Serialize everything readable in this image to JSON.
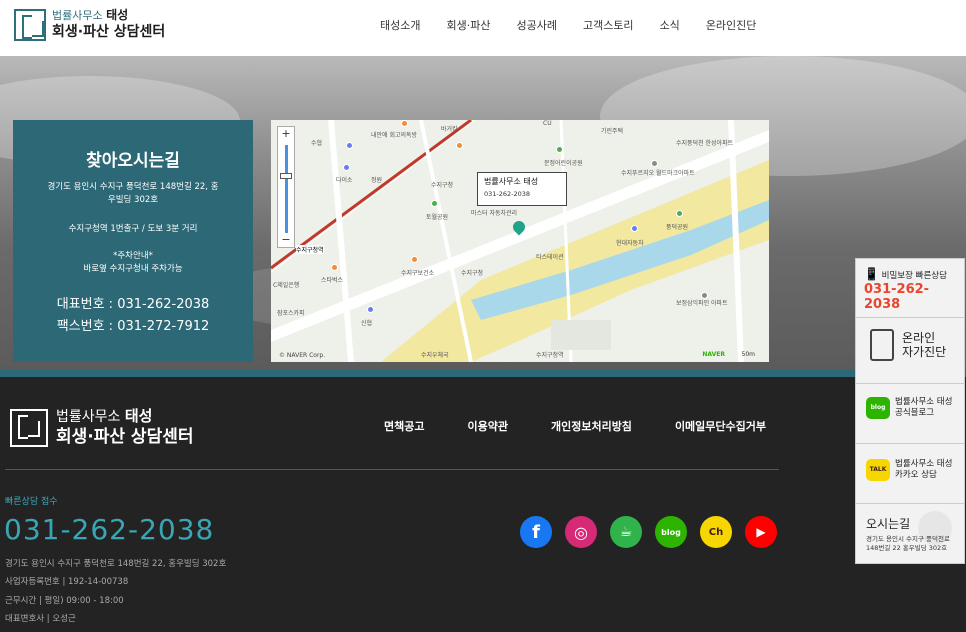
{
  "header": {
    "logo_line1_prefix": "법률사무소",
    "logo_line1_bold": "태성",
    "logo_line2": "회생·파산 상담센터",
    "nav": [
      "태성소개",
      "회생·파산",
      "성공사례",
      "고객스토리",
      "소식",
      "온라인진단"
    ]
  },
  "location": {
    "title": "찾아오시는길",
    "address": "경기도 용인시 수지구 풍덕천로 148번길 22, 홍우빌딩 302호",
    "transit": "수지구청역 1번출구 / 도보 3분 거리",
    "parking_title": "*주차안내*",
    "parking_text": "바로옆 수지구청내 주차가능",
    "phone_label": "대표번호 : 031-262-2038",
    "fax_label": "팩스번호 : 031-272-7912"
  },
  "map": {
    "callout_name": "법률사무소 태성",
    "callout_phone": "031-262-2038",
    "labels": [
      "수협",
      "내안애 회고의독방",
      "바거킹",
      "CU",
      "기린주택",
      "다이소",
      "정원",
      "수지구청",
      "문정어린이공원",
      "수지푸르지오 월드마크아파트",
      "수지중학교",
      "수지풍덕천 한성아파트",
      "농협",
      "토월공원",
      "마스터 자동차관리",
      "풍덕공원",
      "현대자동차",
      "수지구청역",
      "천운당",
      "농협",
      "티스테이션",
      "C제일은행",
      "수지구보건소",
      "수지구청",
      "스타벅스",
      "인팩",
      "법조타운7번길",
      "잠포스카피",
      "수지구청역",
      "수지우체국",
      "보정삼익파인 아파트",
      "신협"
    ],
    "zoom_plus": "+",
    "zoom_minus": "−",
    "provider": "NAVER",
    "corp": "© NAVER Corp.",
    "scale": "50m"
  },
  "footer": {
    "logo_line1_prefix": "법률사무소",
    "logo_line1_bold": "태성",
    "logo_line2": "회생·파산 상담센터",
    "links": [
      "면책공고",
      "이용약관",
      "개인정보처리방침",
      "이메일무단수집거부"
    ],
    "quick_label": "빠른상담 접수",
    "phone": "031-262-2038",
    "info": [
      "경기도 용인시 수지구 풍덕천로 148번길 22, 홍우빌딩 302호",
      "사업자등록번호 | 192-14-00738",
      "근무시간 | 평일) 09:00 - 18:00",
      "대표변호사 | 오성근"
    ],
    "sns": [
      {
        "name": "facebook-icon",
        "label": "f",
        "color": "#1877f2"
      },
      {
        "name": "instagram-icon",
        "label": "◎",
        "color": "#d62976"
      },
      {
        "name": "kakaostory-icon",
        "label": "☕",
        "color": "#2fb34a"
      },
      {
        "name": "blog-icon",
        "label": "blog",
        "color": "#2db400"
      },
      {
        "name": "kakao-channel-icon",
        "label": "Ch",
        "color": "#f7d600"
      },
      {
        "name": "youtube-icon",
        "label": "▶",
        "color": "#ff0000"
      }
    ]
  },
  "side": {
    "secret_label": "비밀보장 빠른상담",
    "secret_phone": "031-262-2038",
    "diag_line1": "온라인",
    "diag_line2": "자가진단",
    "blog_line1": "법률사무소 태성",
    "blog_line2": "공식블로그",
    "kakao_line1": "법률사무소 태성",
    "kakao_line2": "카카오 상담",
    "loc_title": "오시는길",
    "loc_addr": "경기도 용인시 수지구 풍덕천로 148번길 22 홍우빌딩 302호"
  },
  "colors": {
    "teal": "#2c6875",
    "accent": "#3aa6b5",
    "red": "#e8452c",
    "footer_bg": "#232323"
  }
}
